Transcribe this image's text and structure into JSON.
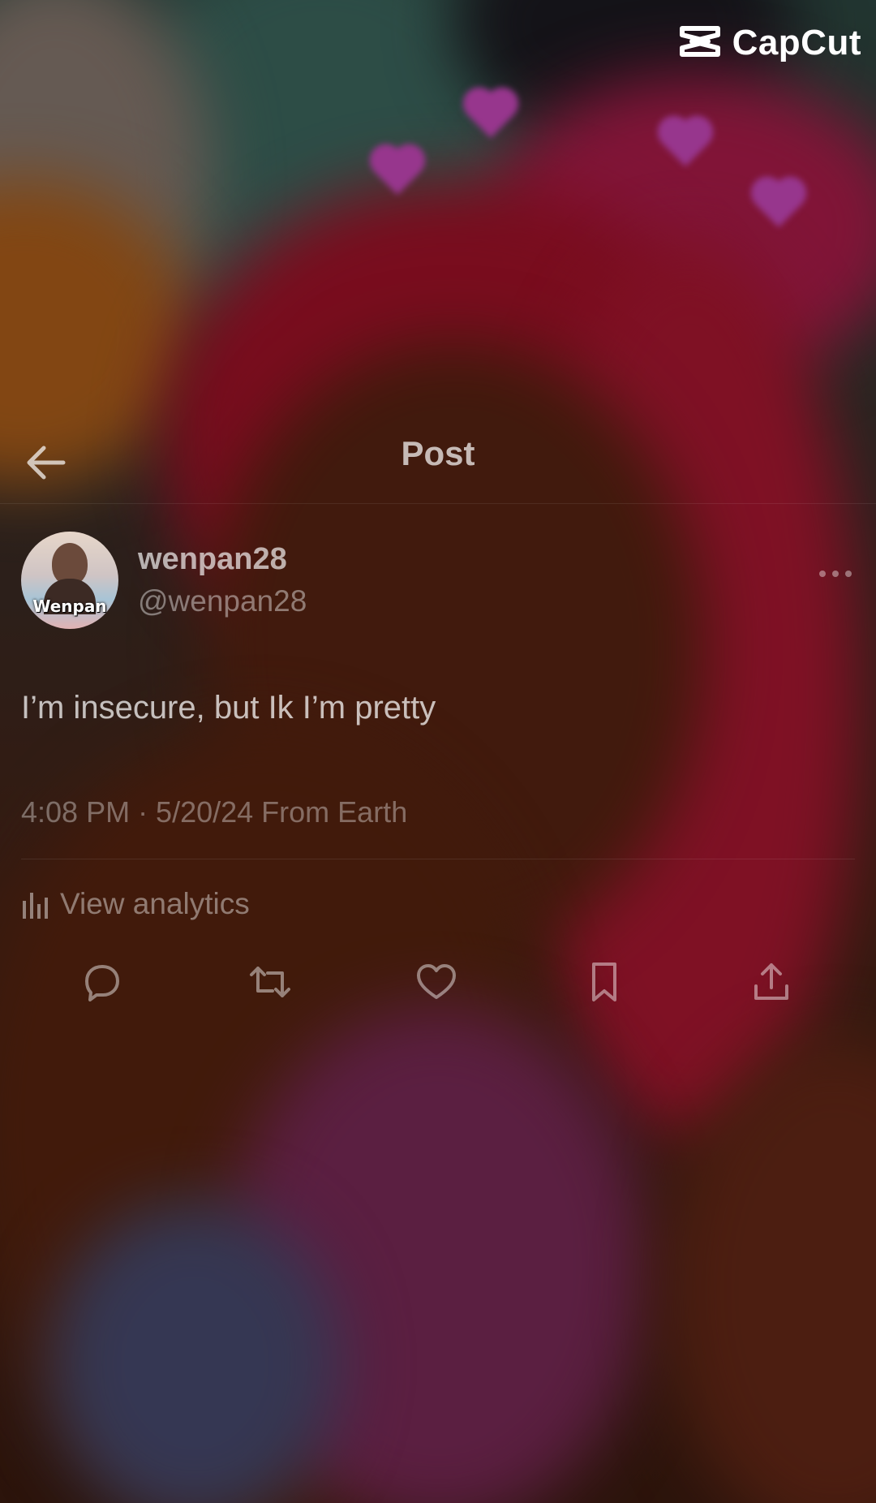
{
  "watermark": {
    "brand": "CapCut",
    "icon": "capcut-logo-icon"
  },
  "header": {
    "title": "Post",
    "back_icon": "back-arrow-icon"
  },
  "post": {
    "author": {
      "display_name": "wenpan28",
      "handle": "@wenpan28",
      "avatar_label": "Wenpan"
    },
    "more_icon": "more-options-icon",
    "text": "I’m insecure, but Ik I’m pretty",
    "meta": "4:08 PM · 5/20/24 From Earth",
    "analytics_label": "View analytics",
    "actions": [
      "reply-icon",
      "repost-icon",
      "like-icon",
      "bookmark-icon",
      "share-icon"
    ]
  },
  "colors": {
    "overlay_text": "#ffffff",
    "hair_red": "#b01833",
    "heart_pink": "#d24bc4"
  }
}
